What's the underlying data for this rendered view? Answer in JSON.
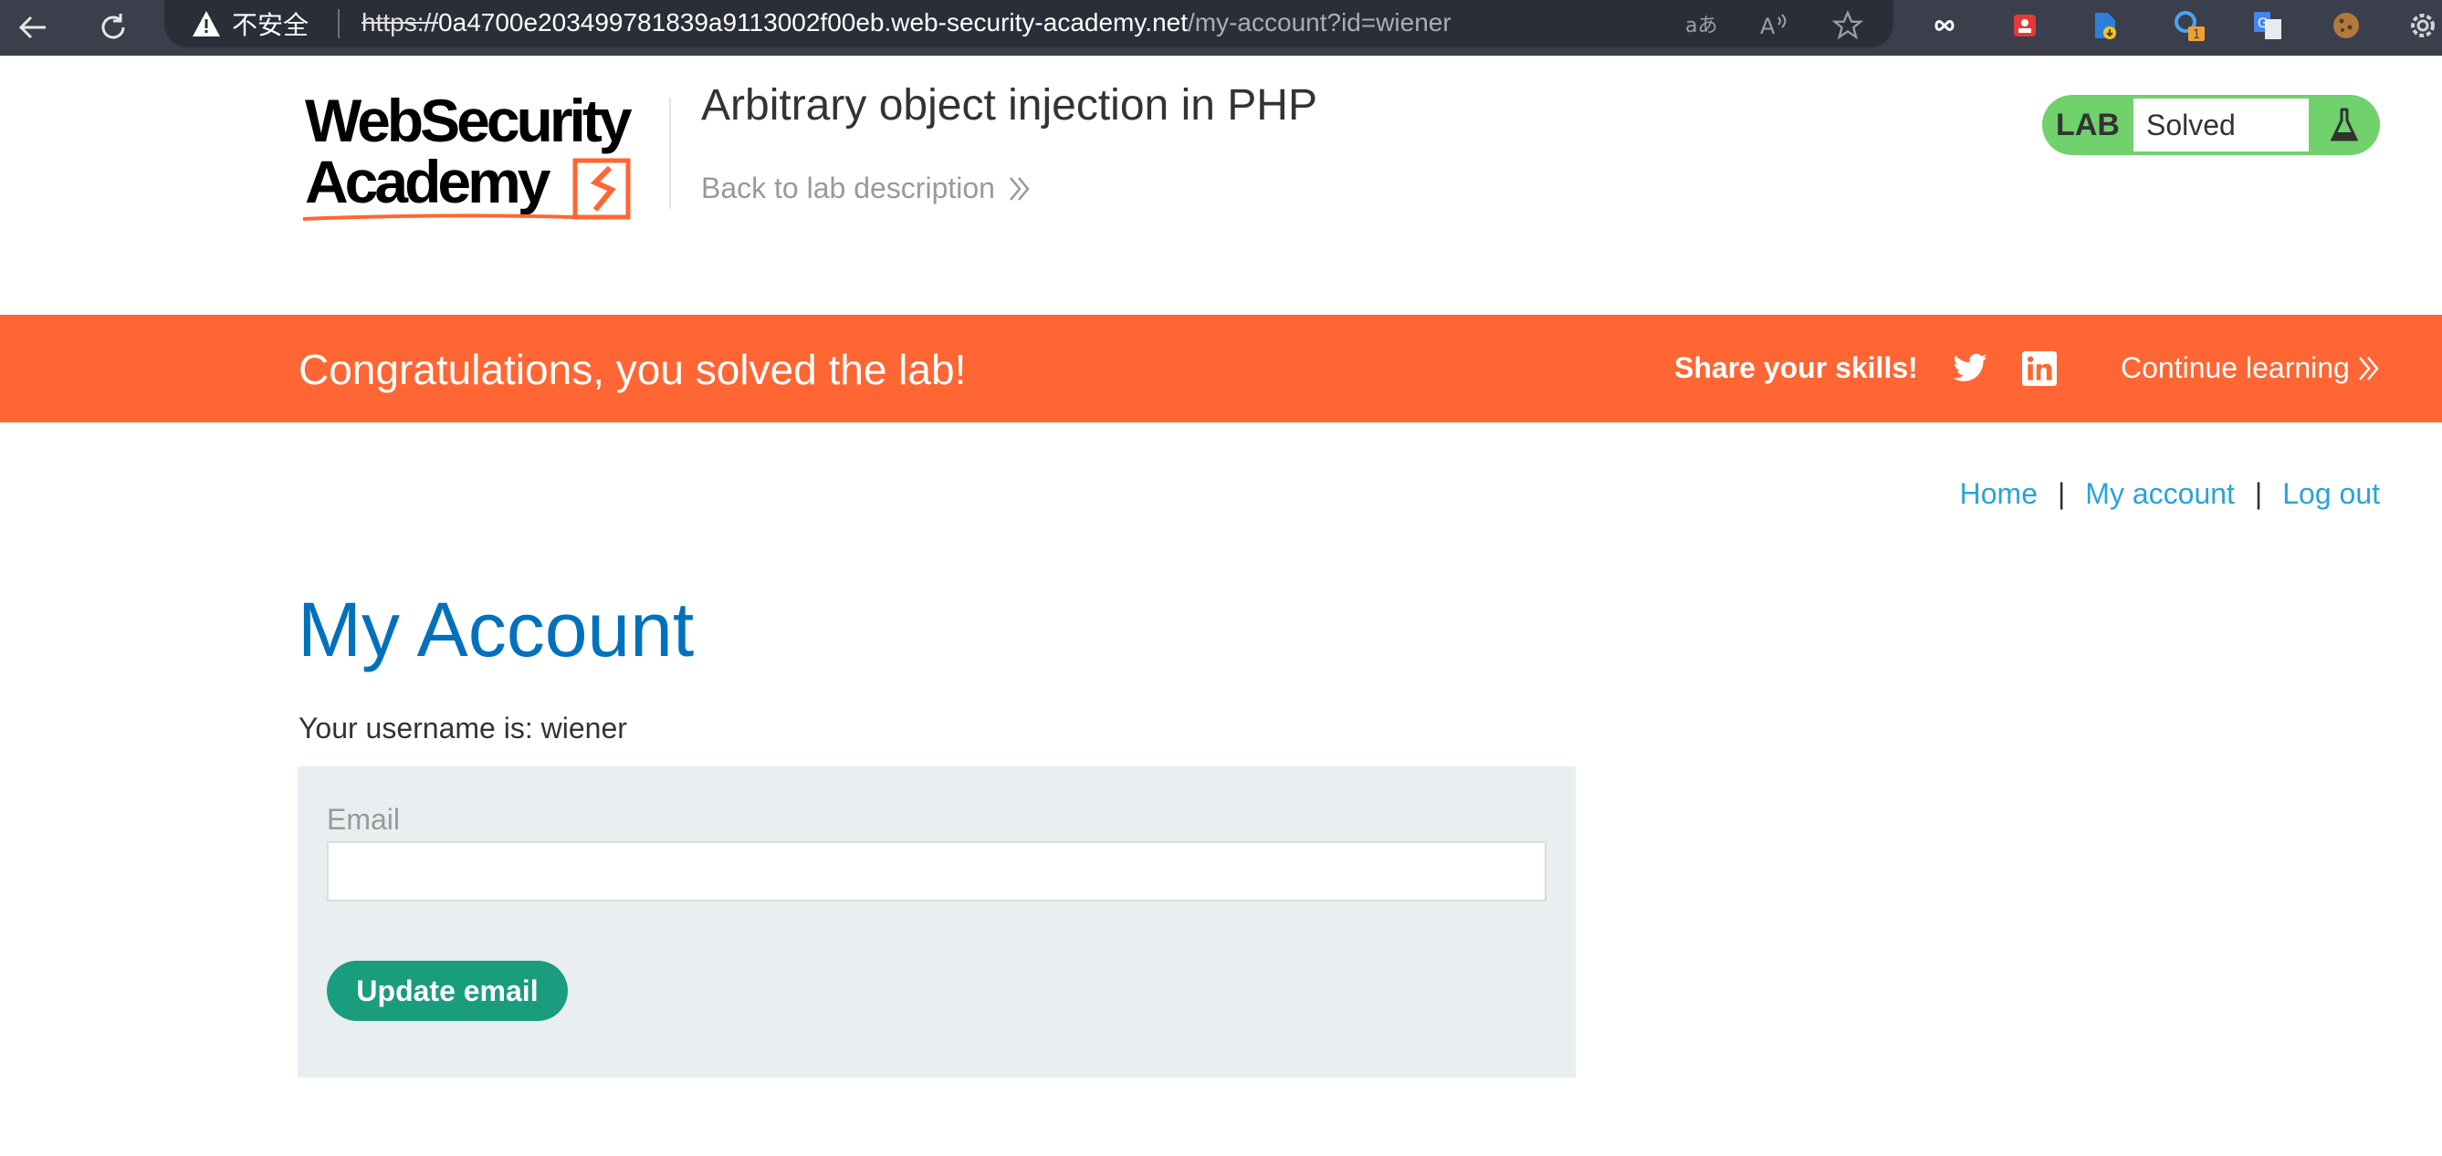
{
  "browser": {
    "security_label": "不安全",
    "url_scheme": "https://",
    "url_host": "0a4700e203499781839a9113002f00eb.web-security-academy.net",
    "url_path": "/my-account?id=wiener",
    "extension_badge": "1"
  },
  "header": {
    "logo_line1": "WebSecurity",
    "logo_line2": "Academy",
    "lab_title": "Arbitrary object injection in PHP",
    "back_link": "Back to lab description",
    "lab_badge_label": "LAB",
    "lab_badge_status": "Solved"
  },
  "banner": {
    "message": "Congratulations, you solved the lab!",
    "share_label": "Share your skills!",
    "continue_label": "Continue learning"
  },
  "nav": {
    "home": "Home",
    "my_account": "My account",
    "log_out": "Log out",
    "separator": "|"
  },
  "main": {
    "title": "My Account",
    "username_line": "Your username is: wiener",
    "email_label": "Email",
    "email_value": "",
    "update_button": "Update email"
  },
  "colors": {
    "banner_orange": "#ff6633",
    "title_blue": "#0071bc",
    "link_blue": "#29a3d6",
    "button_green": "#1a9c7f",
    "solved_green": "#70d16d",
    "panel_grey": "#e9eef0"
  },
  "icons": {
    "back": "arrow-left-icon",
    "refresh": "refresh-icon",
    "warning": "warning-icon",
    "translate": "translate-icon",
    "read_aloud": "read-aloud-icon",
    "favorite": "star-icon",
    "twitter": "twitter-icon",
    "linkedin": "linkedin-icon",
    "flask": "flask-icon"
  }
}
